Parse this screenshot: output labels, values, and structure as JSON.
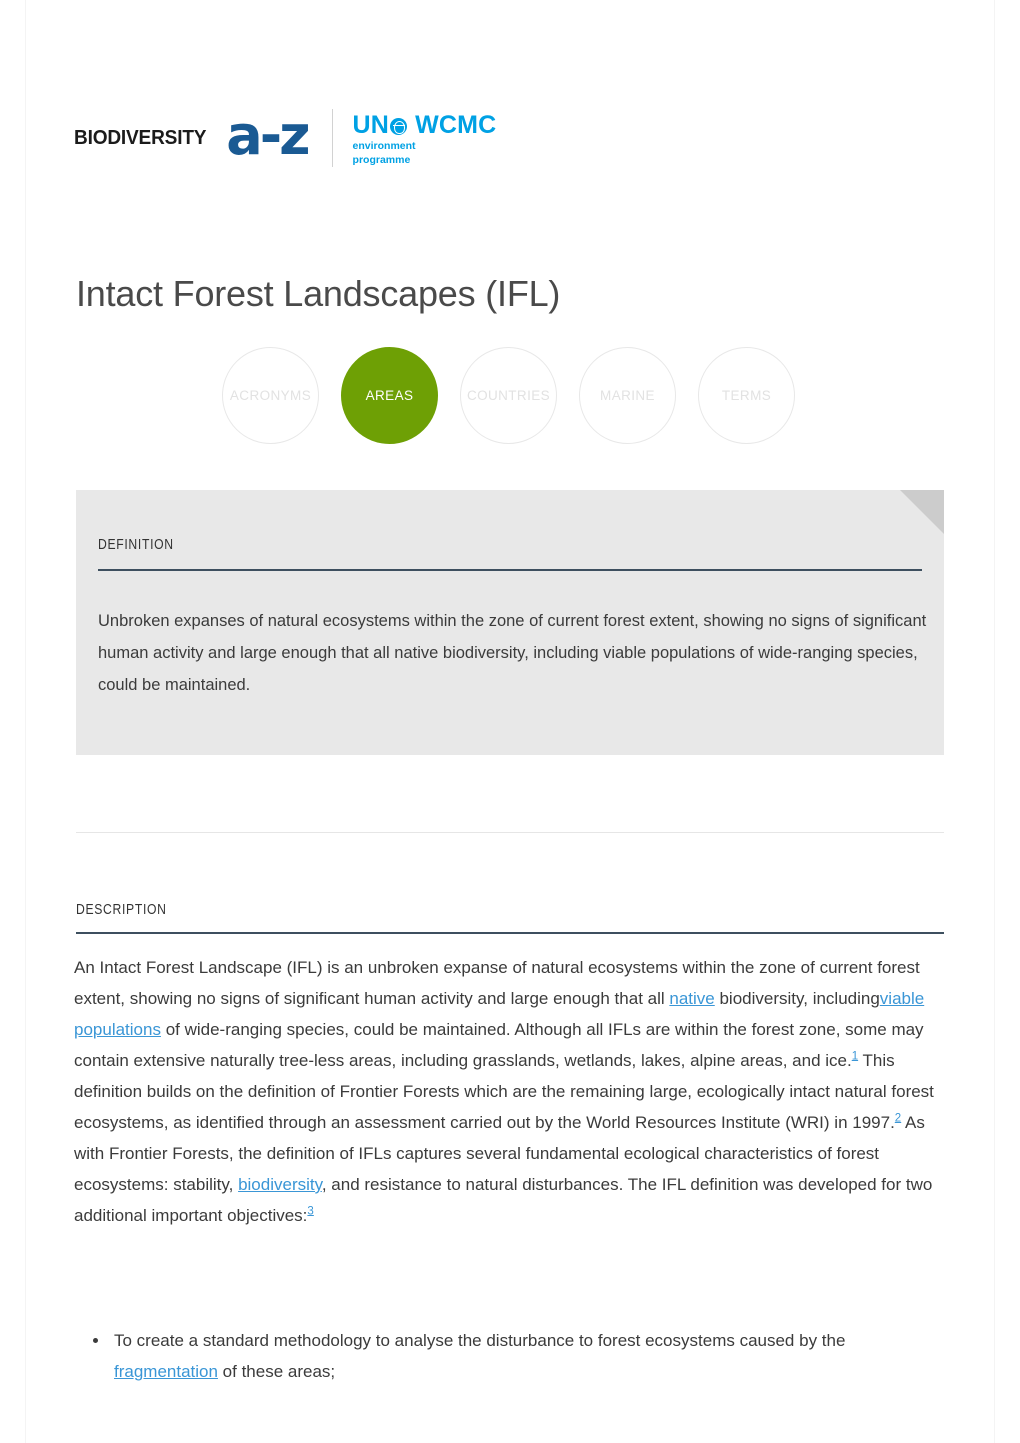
{
  "logo": {
    "biodiversity_word": "BIODIVERSITY",
    "az_mark": "a-z",
    "unep_main": "UN",
    "unep_wcmc": "WCMC",
    "unep_sub_line1": "environment",
    "unep_sub_line2": "programme",
    "brand_blue": "#1a5a93",
    "unep_blue": "#00a1e4"
  },
  "page": {
    "title": "Intact Forest Landscapes (IFL)"
  },
  "categories": {
    "active_color": "#6ea005",
    "items": [
      {
        "label": "ACRONYMS",
        "active": false
      },
      {
        "label": "AREAS",
        "active": true
      },
      {
        "label": "COUNTRIES",
        "active": false
      },
      {
        "label": "MARINE",
        "active": false
      },
      {
        "label": "TERMS",
        "active": false
      }
    ]
  },
  "definition": {
    "heading": "DEFINITION",
    "text": "Unbroken expanses of natural ecosystems within the zone of current forest extent, showing no signs of significant human activity and large enough that all native biodiversity, including viable populations of wide-ranging species, could be maintained."
  },
  "description": {
    "heading": "DESCRIPTION",
    "p1_part1": "An Intact Forest Landscape (IFL) is an unbroken expanse of natural ecosystems within the zone of current forest extent, showing no signs of significant human activity and large enough that all ",
    "link_native": "native",
    "p1_part2": " biodiversity, including",
    "link_viable_populations": "viable populations",
    "p1_part3": " of wide-ranging species, could be maintained. Although all IFLs are within the forest zone, some may contain extensive naturally tree-less areas, including grasslands, wetlands, lakes, alpine areas, and ice.",
    "footnote_1": "1",
    "p1_part4": " This definition builds on the definition of Frontier Forests which are the remaining large, ecologically intact natural forest ecosystems, as identified through an assessment carried out by the World Resources Institute (WRI) in 1997.",
    "footnote_2": "2",
    "p1_part5": " As with Frontier Forests, the definition of IFLs captures several fundamental ecological characteristics of forest ecosystems: stability, ",
    "link_biodiversity": "biodiversity",
    "p1_part6": ", and resistance to natural disturbances. The IFL definition was developed for two additional important objectives:",
    "footnote_3": "3",
    "link_color": "#3a96d6"
  },
  "objectives": {
    "item1_part1": "To create a standard methodology to analyse the disturbance to forest ecosystems caused by the ",
    "item1_link": "fragmentation",
    "item1_part2": " of these areas;"
  }
}
